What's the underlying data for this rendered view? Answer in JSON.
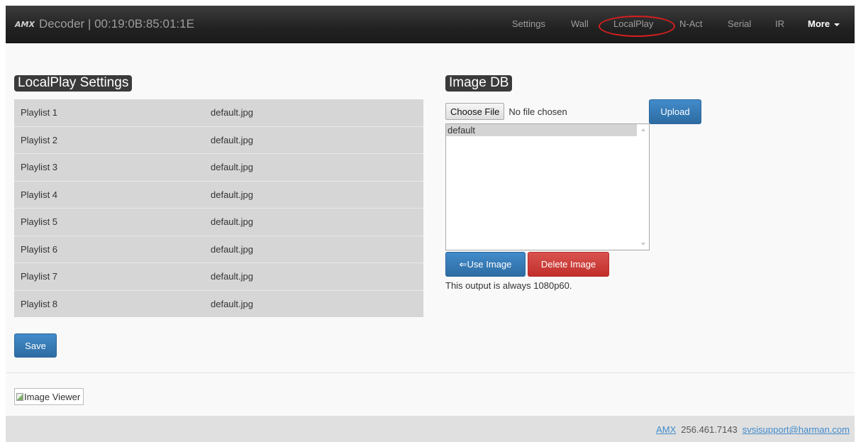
{
  "navbar": {
    "logo_text": "AMX",
    "title": "Decoder | 00:19:0B:85:01:1E",
    "items": [
      {
        "label": "Settings"
      },
      {
        "label": "Wall"
      },
      {
        "label": "LocalPlay"
      },
      {
        "label": "N-Act"
      },
      {
        "label": "Serial"
      },
      {
        "label": "IR"
      },
      {
        "label": "More"
      }
    ],
    "highlight_color": "#d81e1e"
  },
  "localplay": {
    "heading": "LocalPlay Settings",
    "rows": [
      {
        "name": "Playlist 1",
        "value": "default.jpg"
      },
      {
        "name": "Playlist 2",
        "value": "default.jpg"
      },
      {
        "name": "Playlist 3",
        "value": "default.jpg"
      },
      {
        "name": "Playlist 4",
        "value": "default.jpg"
      },
      {
        "name": "Playlist 5",
        "value": "default.jpg"
      },
      {
        "name": "Playlist 6",
        "value": "default.jpg"
      },
      {
        "name": "Playlist 7",
        "value": "default.jpg"
      },
      {
        "name": "Playlist 8",
        "value": "default.jpg"
      }
    ],
    "save_label": "Save"
  },
  "image_db": {
    "heading": "Image DB",
    "choose_file_label": "Choose File",
    "no_file_text": "No file chosen",
    "upload_label": "Upload",
    "images": [
      "default"
    ],
    "use_image_label": "⇐Use Image",
    "delete_image_label": "Delete Image",
    "note": "This output is always 1080p60."
  },
  "image_viewer": {
    "alt_text": "Image Viewer"
  },
  "footer": {
    "company": "AMX",
    "phone": "256.461.7143",
    "email": "svsisupport@harman.com"
  },
  "colors": {
    "primary": "#428bca",
    "danger": "#d9534f",
    "navbar_bg": "#222222"
  }
}
